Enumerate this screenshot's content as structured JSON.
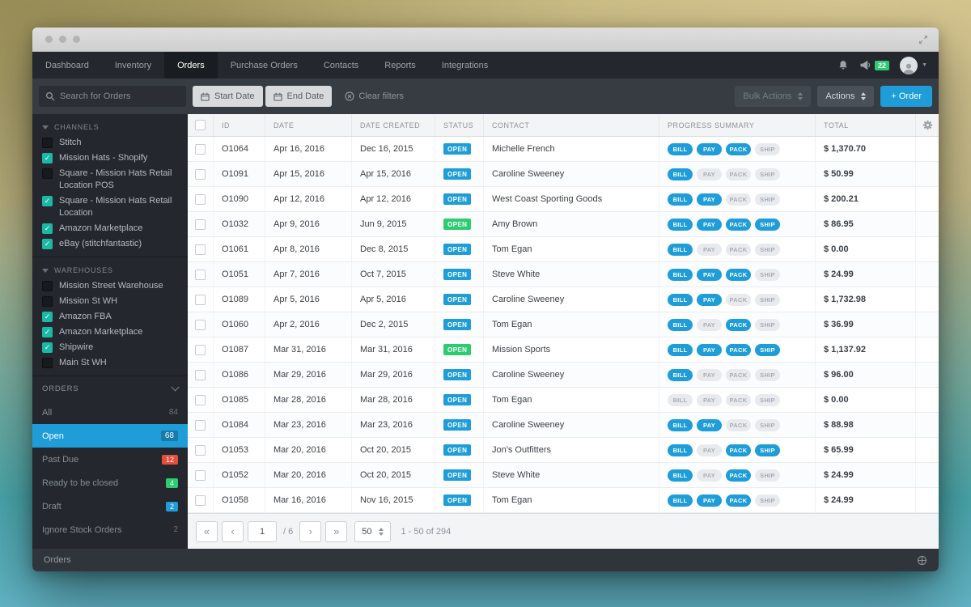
{
  "colors": {
    "accent_blue": "#1e9dd8",
    "success_green": "#2ecc71",
    "danger_red": "#e74c3c",
    "checkbox_teal": "#1bb8a5"
  },
  "icons": {
    "check": "✓",
    "caret_down": "▼",
    "first_page": "«",
    "prev_page": "‹",
    "next_page": "›",
    "last_page": "»"
  },
  "nav": {
    "tabs": [
      {
        "label": "Dashboard",
        "active": false
      },
      {
        "label": "Inventory",
        "active": false
      },
      {
        "label": "Orders",
        "active": true
      },
      {
        "label": "Purchase Orders",
        "active": false
      },
      {
        "label": "Contacts",
        "active": false
      },
      {
        "label": "Reports",
        "active": false
      },
      {
        "label": "Integrations",
        "active": false
      }
    ],
    "notification_count": "22"
  },
  "toolbar": {
    "search_placeholder": "Search for Orders",
    "start_date_label": "Start Date",
    "end_date_label": "End Date",
    "clear_filters_label": "Clear filters",
    "bulk_actions_label": "Bulk Actions",
    "actions_label": "Actions",
    "add_order_label": "+ Order"
  },
  "sidebar": {
    "channels": {
      "title": "CHANNELS",
      "items": [
        {
          "label": "Stitch",
          "checked": false
        },
        {
          "label": "Mission Hats - Shopify",
          "checked": true
        },
        {
          "label": "Square - Mission Hats Retail Location POS",
          "checked": false
        },
        {
          "label": "Square - Mission Hats Retail Location",
          "checked": true
        },
        {
          "label": "Amazon Marketplace",
          "checked": true
        },
        {
          "label": "eBay (stitchfantastic)",
          "checked": true
        }
      ]
    },
    "warehouses": {
      "title": "WAREHOUSES",
      "items": [
        {
          "label": "Mission Street Warehouse",
          "checked": false
        },
        {
          "label": "Mission St WH",
          "checked": false
        },
        {
          "label": "Amazon FBA",
          "checked": true
        },
        {
          "label": "Amazon Marketplace",
          "checked": true
        },
        {
          "label": "Shipwire",
          "checked": true
        },
        {
          "label": "Main St WH",
          "checked": false
        }
      ]
    },
    "orders_section": {
      "title": "ORDERS",
      "items": [
        {
          "label": "All",
          "count": "84",
          "badge": "none",
          "selected": false
        },
        {
          "label": "Open",
          "count": "68",
          "badge": "none",
          "selected": true
        },
        {
          "label": "Past Due",
          "count": "12",
          "badge": "red",
          "selected": false
        },
        {
          "label": "Ready to be closed",
          "count": "4",
          "badge": "green",
          "selected": false
        },
        {
          "label": "Draft",
          "count": "2",
          "badge": "blue",
          "selected": false
        },
        {
          "label": "Ignore Stock Orders",
          "count": "2",
          "badge": "none",
          "selected": false
        }
      ]
    }
  },
  "table": {
    "columns": [
      "ID",
      "DATE",
      "DATE CREATED",
      "STATUS",
      "CONTACT",
      "PROGRESS SUMMARY",
      "TOTAL"
    ],
    "progress_labels": [
      "BILL",
      "PAY",
      "PACK",
      "SHIP"
    ],
    "rows": [
      {
        "id": "O1064",
        "date": "Apr 16, 2016",
        "date_created": "Dec 16, 2015",
        "status": "OPEN",
        "status_color": "blue",
        "contact": "Michelle French",
        "progress": [
          true,
          true,
          true,
          false
        ],
        "total": "$ 1,370.70"
      },
      {
        "id": "O1091",
        "date": "Apr 15, 2016",
        "date_created": "Apr 15, 2016",
        "status": "OPEN",
        "status_color": "blue",
        "contact": "Caroline Sweeney",
        "progress": [
          true,
          false,
          false,
          false
        ],
        "total": "$ 50.99"
      },
      {
        "id": "O1090",
        "date": "Apr 12, 2016",
        "date_created": "Apr 12, 2016",
        "status": "OPEN",
        "status_color": "blue",
        "contact": "West Coast Sporting Goods",
        "progress": [
          true,
          true,
          false,
          false
        ],
        "total": "$ 200.21"
      },
      {
        "id": "O1032",
        "date": "Apr 9, 2016",
        "date_created": "Jun 9, 2015",
        "status": "OPEN",
        "status_color": "green",
        "contact": "Amy Brown",
        "progress": [
          true,
          true,
          true,
          true
        ],
        "total": "$ 86.95"
      },
      {
        "id": "O1061",
        "date": "Apr 8, 2016",
        "date_created": "Dec 8, 2015",
        "status": "OPEN",
        "status_color": "blue",
        "contact": "Tom Egan",
        "progress": [
          true,
          false,
          false,
          false
        ],
        "total": "$ 0.00"
      },
      {
        "id": "O1051",
        "date": "Apr 7, 2016",
        "date_created": "Oct 7, 2015",
        "status": "OPEN",
        "status_color": "blue",
        "contact": "Steve White",
        "progress": [
          true,
          true,
          true,
          false
        ],
        "total": "$ 24.99"
      },
      {
        "id": "O1089",
        "date": "Apr 5, 2016",
        "date_created": "Apr 5, 2016",
        "status": "OPEN",
        "status_color": "blue",
        "contact": "Caroline Sweeney",
        "progress": [
          true,
          true,
          false,
          false
        ],
        "total": "$ 1,732.98"
      },
      {
        "id": "O1060",
        "date": "Apr 2, 2016",
        "date_created": "Dec 2, 2015",
        "status": "OPEN",
        "status_color": "blue",
        "contact": "Tom Egan",
        "progress": [
          true,
          false,
          true,
          false
        ],
        "total": "$ 36.99"
      },
      {
        "id": "O1087",
        "date": "Mar 31, 2016",
        "date_created": "Mar 31, 2016",
        "status": "OPEN",
        "status_color": "green",
        "contact": "Mission Sports",
        "progress": [
          true,
          true,
          true,
          true
        ],
        "total": "$ 1,137.92"
      },
      {
        "id": "O1086",
        "date": "Mar 29, 2016",
        "date_created": "Mar 29, 2016",
        "status": "OPEN",
        "status_color": "blue",
        "contact": "Caroline Sweeney",
        "progress": [
          true,
          false,
          false,
          false
        ],
        "total": "$ 96.00"
      },
      {
        "id": "O1085",
        "date": "Mar 28, 2016",
        "date_created": "Mar 28, 2016",
        "status": "OPEN",
        "status_color": "blue",
        "contact": "Tom Egan",
        "progress": [
          false,
          false,
          false,
          false
        ],
        "total": "$ 0.00"
      },
      {
        "id": "O1084",
        "date": "Mar 23, 2016",
        "date_created": "Mar 23, 2016",
        "status": "OPEN",
        "status_color": "blue",
        "contact": "Caroline Sweeney",
        "progress": [
          true,
          true,
          false,
          false
        ],
        "total": "$ 88.98"
      },
      {
        "id": "O1053",
        "date": "Mar 20, 2016",
        "date_created": "Oct 20, 2015",
        "status": "OPEN",
        "status_color": "blue",
        "contact": "Jon's Outfitters",
        "progress": [
          true,
          false,
          true,
          true
        ],
        "total": "$ 65.99"
      },
      {
        "id": "O1052",
        "date": "Mar 20, 2016",
        "date_created": "Oct 20, 2015",
        "status": "OPEN",
        "status_color": "blue",
        "contact": "Steve White",
        "progress": [
          true,
          false,
          true,
          false
        ],
        "total": "$ 24.99"
      },
      {
        "id": "O1058",
        "date": "Mar 16, 2016",
        "date_created": "Nov 16, 2015",
        "status": "OPEN",
        "status_color": "blue",
        "contact": "Tom Egan",
        "progress": [
          true,
          true,
          true,
          false
        ],
        "total": "$ 24.99"
      }
    ]
  },
  "pagination": {
    "page_value": "1",
    "of_label": "/ 6",
    "page_size": "50",
    "range_label": "1 - 50 of 294"
  },
  "statusbar": {
    "label": "Orders"
  }
}
